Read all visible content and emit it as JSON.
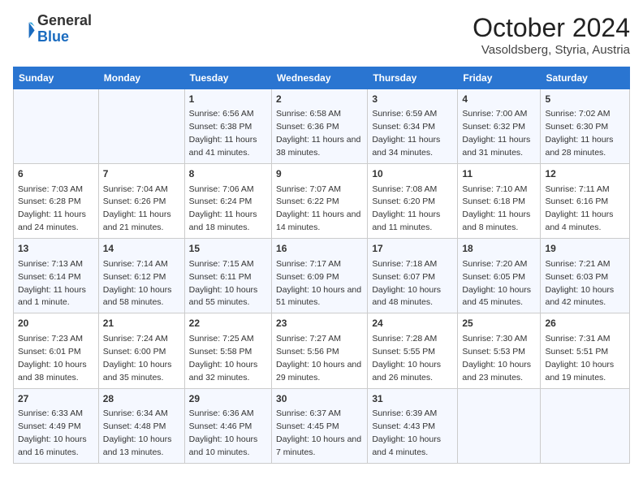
{
  "header": {
    "logo_general": "General",
    "logo_blue": "Blue",
    "month_title": "October 2024",
    "location": "Vasoldsberg, Styria, Austria"
  },
  "weekdays": [
    "Sunday",
    "Monday",
    "Tuesday",
    "Wednesday",
    "Thursday",
    "Friday",
    "Saturday"
  ],
  "weeks": [
    [
      {
        "day": "",
        "info": ""
      },
      {
        "day": "",
        "info": ""
      },
      {
        "day": "1",
        "info": "Sunrise: 6:56 AM\nSunset: 6:38 PM\nDaylight: 11 hours and 41 minutes."
      },
      {
        "day": "2",
        "info": "Sunrise: 6:58 AM\nSunset: 6:36 PM\nDaylight: 11 hours and 38 minutes."
      },
      {
        "day": "3",
        "info": "Sunrise: 6:59 AM\nSunset: 6:34 PM\nDaylight: 11 hours and 34 minutes."
      },
      {
        "day": "4",
        "info": "Sunrise: 7:00 AM\nSunset: 6:32 PM\nDaylight: 11 hours and 31 minutes."
      },
      {
        "day": "5",
        "info": "Sunrise: 7:02 AM\nSunset: 6:30 PM\nDaylight: 11 hours and 28 minutes."
      }
    ],
    [
      {
        "day": "6",
        "info": "Sunrise: 7:03 AM\nSunset: 6:28 PM\nDaylight: 11 hours and 24 minutes."
      },
      {
        "day": "7",
        "info": "Sunrise: 7:04 AM\nSunset: 6:26 PM\nDaylight: 11 hours and 21 minutes."
      },
      {
        "day": "8",
        "info": "Sunrise: 7:06 AM\nSunset: 6:24 PM\nDaylight: 11 hours and 18 minutes."
      },
      {
        "day": "9",
        "info": "Sunrise: 7:07 AM\nSunset: 6:22 PM\nDaylight: 11 hours and 14 minutes."
      },
      {
        "day": "10",
        "info": "Sunrise: 7:08 AM\nSunset: 6:20 PM\nDaylight: 11 hours and 11 minutes."
      },
      {
        "day": "11",
        "info": "Sunrise: 7:10 AM\nSunset: 6:18 PM\nDaylight: 11 hours and 8 minutes."
      },
      {
        "day": "12",
        "info": "Sunrise: 7:11 AM\nSunset: 6:16 PM\nDaylight: 11 hours and 4 minutes."
      }
    ],
    [
      {
        "day": "13",
        "info": "Sunrise: 7:13 AM\nSunset: 6:14 PM\nDaylight: 11 hours and 1 minute."
      },
      {
        "day": "14",
        "info": "Sunrise: 7:14 AM\nSunset: 6:12 PM\nDaylight: 10 hours and 58 minutes."
      },
      {
        "day": "15",
        "info": "Sunrise: 7:15 AM\nSunset: 6:11 PM\nDaylight: 10 hours and 55 minutes."
      },
      {
        "day": "16",
        "info": "Sunrise: 7:17 AM\nSunset: 6:09 PM\nDaylight: 10 hours and 51 minutes."
      },
      {
        "day": "17",
        "info": "Sunrise: 7:18 AM\nSunset: 6:07 PM\nDaylight: 10 hours and 48 minutes."
      },
      {
        "day": "18",
        "info": "Sunrise: 7:20 AM\nSunset: 6:05 PM\nDaylight: 10 hours and 45 minutes."
      },
      {
        "day": "19",
        "info": "Sunrise: 7:21 AM\nSunset: 6:03 PM\nDaylight: 10 hours and 42 minutes."
      }
    ],
    [
      {
        "day": "20",
        "info": "Sunrise: 7:23 AM\nSunset: 6:01 PM\nDaylight: 10 hours and 38 minutes."
      },
      {
        "day": "21",
        "info": "Sunrise: 7:24 AM\nSunset: 6:00 PM\nDaylight: 10 hours and 35 minutes."
      },
      {
        "day": "22",
        "info": "Sunrise: 7:25 AM\nSunset: 5:58 PM\nDaylight: 10 hours and 32 minutes."
      },
      {
        "day": "23",
        "info": "Sunrise: 7:27 AM\nSunset: 5:56 PM\nDaylight: 10 hours and 29 minutes."
      },
      {
        "day": "24",
        "info": "Sunrise: 7:28 AM\nSunset: 5:55 PM\nDaylight: 10 hours and 26 minutes."
      },
      {
        "day": "25",
        "info": "Sunrise: 7:30 AM\nSunset: 5:53 PM\nDaylight: 10 hours and 23 minutes."
      },
      {
        "day": "26",
        "info": "Sunrise: 7:31 AM\nSunset: 5:51 PM\nDaylight: 10 hours and 19 minutes."
      }
    ],
    [
      {
        "day": "27",
        "info": "Sunrise: 6:33 AM\nSunset: 4:49 PM\nDaylight: 10 hours and 16 minutes."
      },
      {
        "day": "28",
        "info": "Sunrise: 6:34 AM\nSunset: 4:48 PM\nDaylight: 10 hours and 13 minutes."
      },
      {
        "day": "29",
        "info": "Sunrise: 6:36 AM\nSunset: 4:46 PM\nDaylight: 10 hours and 10 minutes."
      },
      {
        "day": "30",
        "info": "Sunrise: 6:37 AM\nSunset: 4:45 PM\nDaylight: 10 hours and 7 minutes."
      },
      {
        "day": "31",
        "info": "Sunrise: 6:39 AM\nSunset: 4:43 PM\nDaylight: 10 hours and 4 minutes."
      },
      {
        "day": "",
        "info": ""
      },
      {
        "day": "",
        "info": ""
      }
    ]
  ]
}
